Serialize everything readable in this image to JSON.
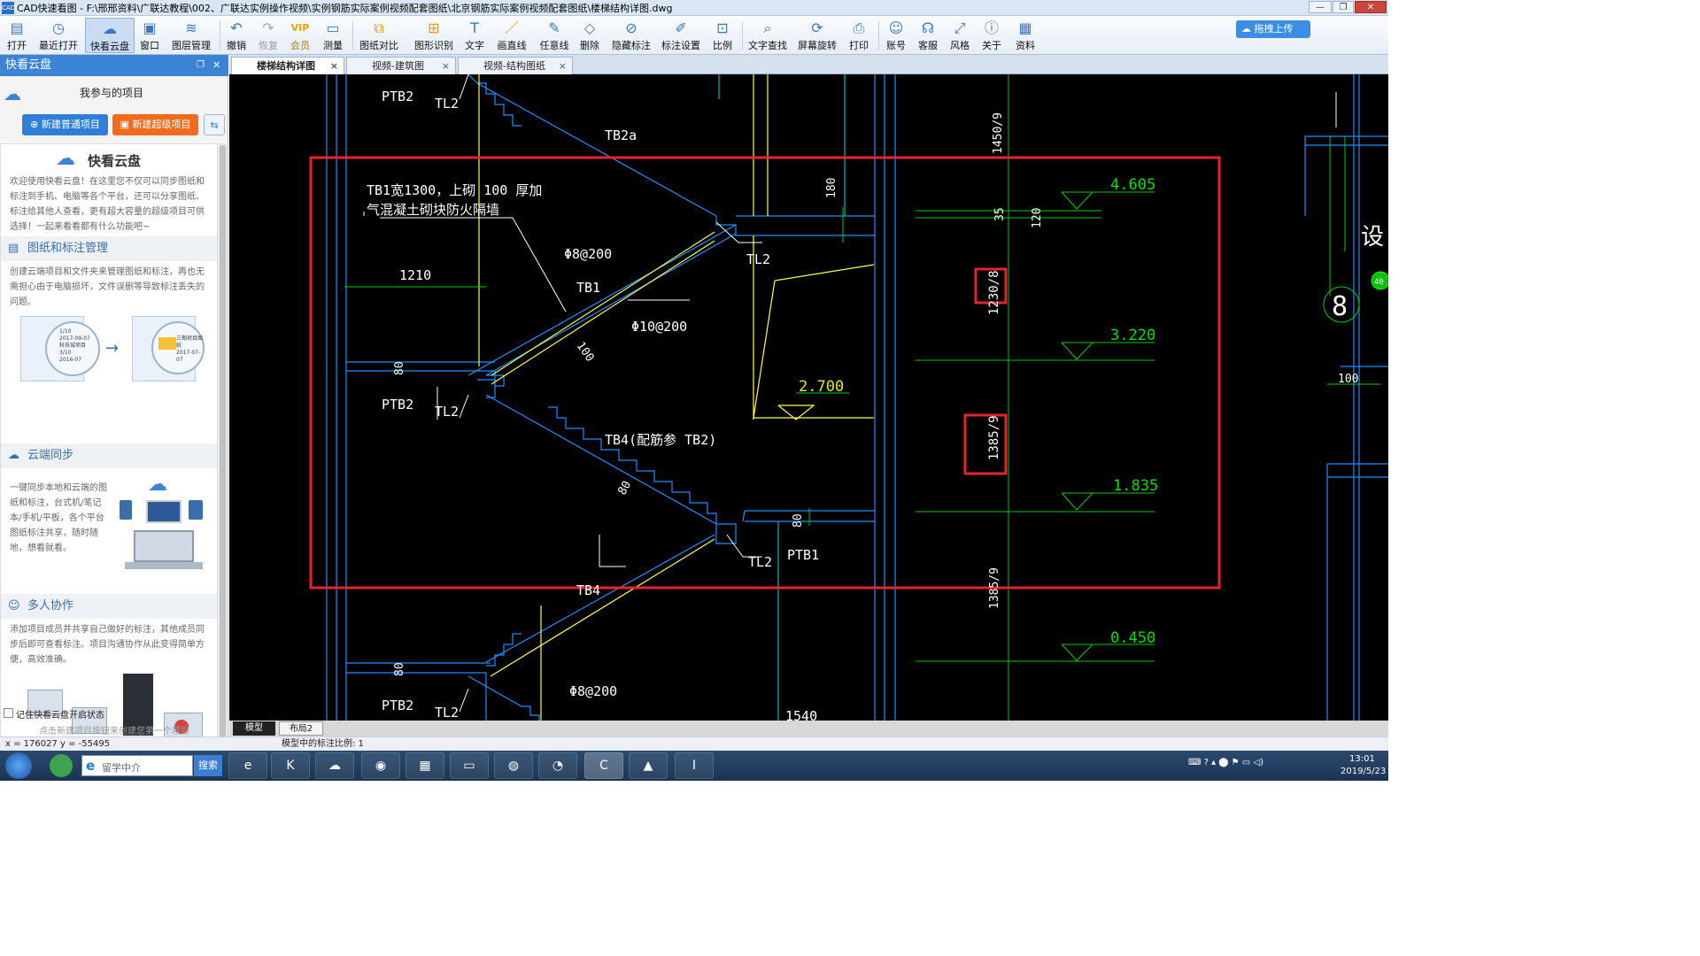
{
  "window": {
    "title": "CAD快速看图 - F:\\邢邢资料\\广联达教程\\002、广联达实例操作视频\\实例钢筋实际案例视频配套图纸\\北京钢筋实际案例视频配套图纸\\楼梯结构详图.dwg",
    "app_icon_text": "CAD",
    "minimize": "—",
    "restore": "❐",
    "close": "✕"
  },
  "toolbar": {
    "items": [
      {
        "label": "打开",
        "icon": "folder-open-icon"
      },
      {
        "label": "最近打开",
        "icon": "clock-icon"
      },
      {
        "label": "快看云盘",
        "icon": "cloud-icon"
      },
      {
        "label": "窗口",
        "icon": "window-icon"
      },
      {
        "label": "图层管理",
        "icon": "layers-icon"
      },
      {
        "label": "撤销",
        "icon": "undo-icon"
      },
      {
        "label": "恢复",
        "icon": "redo-icon"
      },
      {
        "label": "会员",
        "icon": "vip-icon"
      },
      {
        "label": "测量",
        "icon": "ruler-icon"
      },
      {
        "label": "图纸对比",
        "icon": "compare-icon"
      },
      {
        "label": "图形识别",
        "icon": "shape-recognize-icon"
      },
      {
        "label": "文字",
        "icon": "text-icon"
      },
      {
        "label": "画直线",
        "icon": "line-icon"
      },
      {
        "label": "任意线",
        "icon": "pencil-icon"
      },
      {
        "label": "删除",
        "icon": "eraser-icon"
      },
      {
        "label": "隐藏标注",
        "icon": "hide-icon"
      },
      {
        "label": "标注设置",
        "icon": "annotation-settings-icon"
      },
      {
        "label": "比例",
        "icon": "scale-icon"
      },
      {
        "label": "文字查找",
        "icon": "text-search-icon"
      },
      {
        "label": "屏幕旋转",
        "icon": "rotate-icon"
      },
      {
        "label": "打印",
        "icon": "printer-icon"
      },
      {
        "label": "账号",
        "icon": "account-icon"
      },
      {
        "label": "客服",
        "icon": "headset-icon"
      },
      {
        "label": "风格",
        "icon": "style-icon"
      },
      {
        "label": "关于",
        "icon": "info-icon"
      },
      {
        "label": "资料",
        "icon": "docs-icon"
      }
    ],
    "upload_label": "拖拽上传"
  },
  "left_panel": {
    "header": "快看云盘",
    "my_projects": "我参与的项目",
    "new_normal": "新建普通项目",
    "new_super": "新建超级项目",
    "cloud_title": "快看云盘",
    "intro": "欢迎使用快看云盘！在这里您不仅可以同步图纸和标注到手机、电脑等各个平台，还可以分享图纸、标注给其他人查看，更有超大容量的超级项目可供选择！一起来看看都有什么功能吧~",
    "sec1_title": "图纸和标注管理",
    "sec1_text": "创建云端项目和文件夹来管理图纸和标注，再也无需担心由于电脑损坏，文件误删等导致标注丢失的问题。",
    "sec1_img_a1": "1/10",
    "sec1_img_a2": "2017-09-07",
    "sec1_img_a3": "科技城项目",
    "sec1_img_a4": "3/10",
    "sec1_img_a5": "2016-07",
    "sec1_img_b1": "三期项目图纸",
    "sec1_img_b2": "2017-07-07",
    "sec2_title": "云端同步",
    "sec2_text": "一键同步本地和云端的图纸和标注，台式机/笔记本/手机/平板，各个平台图纸标注共享，随时随地，想看就看。",
    "sec3_title": "多人协作",
    "sec3_text": "添加项目成员并共享自己做好的标注，其他成员同步后即可查看标注。项目沟通协作从此变得简单方便，高效准确。",
    "remember": "记住快看云盘开启状态",
    "hint": "点击新建项目按钮来创建您第一个项目"
  },
  "tabs": [
    {
      "label": "楼梯结构详图"
    },
    {
      "label": "视频-建筑图"
    },
    {
      "label": "视频-结构图纸"
    }
  ],
  "tab_close": "×",
  "drawing": {
    "notes": [
      "TB1宽1300，上砌  100 厚加",
      "气混凝土砌块防火隔墙"
    ],
    "labels": {
      "ptb2_a": "PTB2",
      "tl2_a": "TL2",
      "tb2a": "TB2a",
      "tl2_b": "TL2",
      "phi8": "Φ8@200",
      "tb1": "TB1",
      "phi10": "Φ10@200",
      "dim100": "100",
      "dim1210": "1210",
      "dim80a": "80",
      "ptb2_b": "PTB2",
      "tl2_c": "TL2",
      "tb4": "TB4(配筋参  TB2)",
      "dim80b": "80",
      "dim80c": "80",
      "tl2_d": "TL2",
      "ptb1": "PTB1",
      "tb4b": "TB4",
      "dim80d": "80",
      "ptb2_c": "PTB2",
      "tl2_e": "TL2",
      "phi8b": "Φ8@200",
      "dim1540": "1540",
      "dim180": "180",
      "dim35": "35",
      "dim120": "120",
      "dim1450": "1450/9",
      "dim1230": "1230/8",
      "dim1385": "1385/9",
      "dim1385b": "1385/9",
      "dim100r": "100",
      "circle8": "8",
      "badge40": "40",
      "partial_char": "设"
    },
    "elevations": [
      "4.605",
      "3.220",
      "2.700",
      "1.835",
      "0.450"
    ]
  },
  "bottom_tabs": [
    "模型",
    "布局2"
  ],
  "status": {
    "coords": "x = 176027  y = -55495",
    "scale_text": "模型中的标注比例: 1"
  },
  "taskbar": {
    "search_placeholder": "留学中介",
    "search_button": "搜索",
    "time": "13:01",
    "date": "2019/5/23",
    "apps": [
      "ie-icon",
      "k-browser-icon",
      "baidu-netdisk-icon",
      "firefox-icon",
      "calculator-icon",
      "explorer-icon",
      "360-icon",
      "chrome-icon",
      "cad-viewer-icon",
      "autocad-icon",
      "glodon-icon"
    ]
  }
}
